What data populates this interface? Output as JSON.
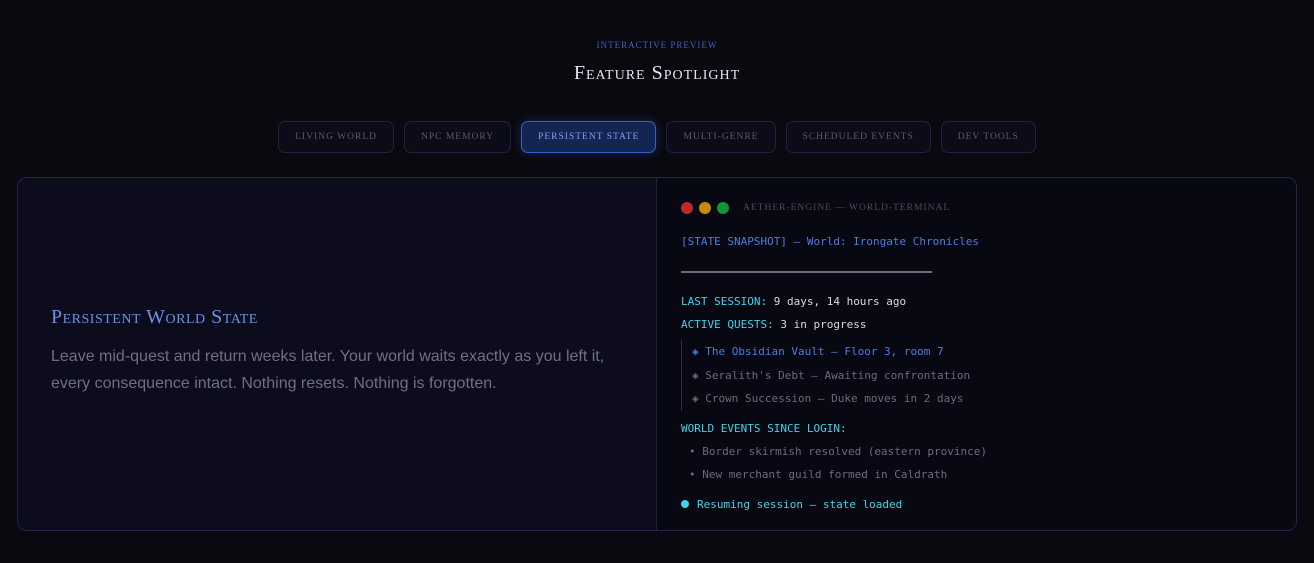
{
  "header": {
    "eyebrow": "Interactive Preview",
    "title": "Feature Spotlight"
  },
  "tabs": [
    {
      "label": "Living World"
    },
    {
      "label": "NPC Memory"
    },
    {
      "label": "Persistent State",
      "active": true
    },
    {
      "label": "Multi-Genre"
    },
    {
      "label": "Scheduled Events"
    },
    {
      "label": "Dev Tools"
    }
  ],
  "feature": {
    "title": "Persistent World State",
    "description": "Leave mid-quest and return weeks later. Your world waits exactly as you left it, every consequence intact. Nothing resets. Nothing is forgotten."
  },
  "terminal": {
    "title": "Aether-Engine — World-Terminal",
    "dot_colors": [
      "#c0262d",
      "#c88a0e",
      "#12963a"
    ],
    "snapshot": "[STATE SNAPSHOT] — World: Irongate Chronicles",
    "last_session_label": "LAST SESSION:",
    "last_session_value": "9 days, 14 hours ago",
    "active_quests_label": "ACTIVE QUESTS:",
    "active_quests_value": "3 in progress",
    "quest_bullet": "◈",
    "quests": [
      "The Obsidian Vault — Floor 3, room 7",
      "Seralith's Debt — Awaiting confrontation",
      "Crown Succession — Duke moves in 2 days"
    ],
    "events_label": "WORLD EVENTS SINCE LOGIN:",
    "event_bullet": "•",
    "events": [
      "Border skirmish resolved (eastern province)",
      "New merchant guild formed in Caldrath"
    ],
    "status": "Resuming session — state loaded"
  }
}
